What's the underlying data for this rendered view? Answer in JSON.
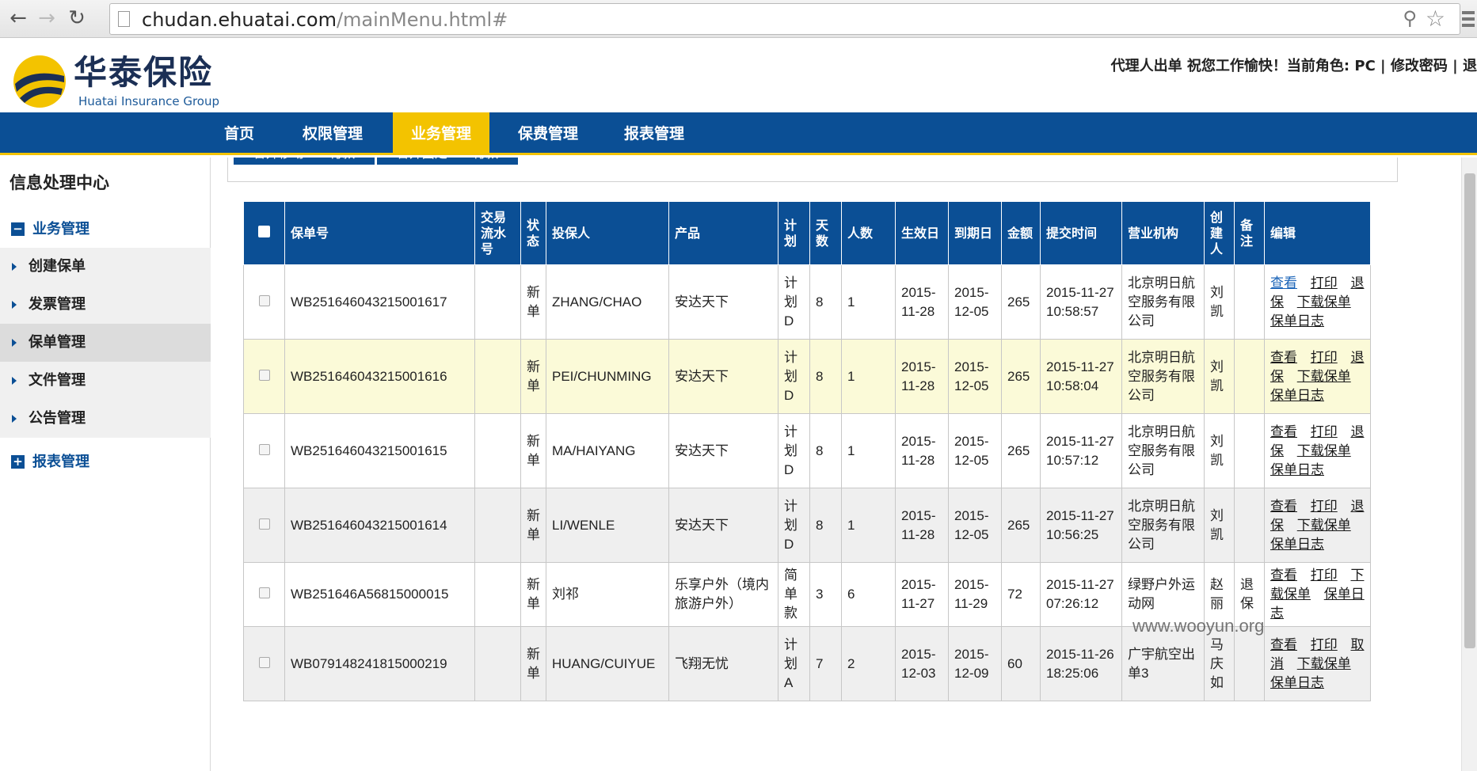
{
  "browser": {
    "url_host": "chudan.ehuatai.com",
    "url_path": "/mainMenu.html#"
  },
  "header": {
    "logo_cn": "华泰保险",
    "logo_en": "Huatai Insurance Group",
    "info": "代理人出单 祝您工作愉快！当前角色: PC | 修改密码 | 退"
  },
  "nav": [
    {
      "label": "首页"
    },
    {
      "label": "权限管理"
    },
    {
      "label": "业务管理",
      "active": true
    },
    {
      "label": "保费管理"
    },
    {
      "label": "报表管理"
    }
  ],
  "sidebar": {
    "title": "信息处理中心",
    "group1": "业务管理",
    "items": [
      {
        "label": "创建保单"
      },
      {
        "label": "发票管理"
      },
      {
        "label": "保单管理",
        "active": true
      },
      {
        "label": "文件管理"
      },
      {
        "label": "公告管理"
      }
    ],
    "group2": "报表管理"
  },
  "top_buttons": [
    "合并移动POS付款",
    "合并固定POS付款"
  ],
  "table": {
    "headers": [
      "保单号",
      "交易流水号",
      "状态",
      "投保人",
      "产品",
      "计划",
      "天数",
      "人数",
      "生效日",
      "到期日",
      "金额",
      "提交时间",
      "营业机构",
      "创建人",
      "备注",
      "编辑"
    ],
    "rows": [
      {
        "policy": "WB251646043215001617",
        "txn": "",
        "status": "新单",
        "holder": "ZHANG/CHAO",
        "product": "安达天下",
        "plan": "计划D",
        "days": "8",
        "people": "1",
        "start": "2015-11-28",
        "end": "2015-12-05",
        "amount": "265",
        "submit": "2015-11-27 10:58:57",
        "org": "北京明日航空服务有限公司",
        "creator": "刘凯",
        "note": "",
        "actions": [
          "查看",
          "打印",
          "退保",
          "下载保单",
          "保单日志"
        ]
      },
      {
        "policy": "WB251646043215001616",
        "txn": "",
        "status": "新单",
        "holder": "PEI/CHUNMING",
        "product": "安达天下",
        "plan": "计划D",
        "days": "8",
        "people": "1",
        "start": "2015-11-28",
        "end": "2015-12-05",
        "amount": "265",
        "submit": "2015-11-27 10:58:04",
        "org": "北京明日航空服务有限公司",
        "creator": "刘凯",
        "note": "",
        "actions": [
          "查看",
          "打印",
          "退保",
          "下载保单",
          "保单日志"
        ]
      },
      {
        "policy": "WB251646043215001615",
        "txn": "",
        "status": "新单",
        "holder": "MA/HAIYANG",
        "product": "安达天下",
        "plan": "计划D",
        "days": "8",
        "people": "1",
        "start": "2015-11-28",
        "end": "2015-12-05",
        "amount": "265",
        "submit": "2015-11-27 10:57:12",
        "org": "北京明日航空服务有限公司",
        "creator": "刘凯",
        "note": "",
        "actions": [
          "查看",
          "打印",
          "退保",
          "下载保单",
          "保单日志"
        ]
      },
      {
        "policy": "WB251646043215001614",
        "txn": "",
        "status": "新单",
        "holder": "LI/WENLE",
        "product": "安达天下",
        "plan": "计划D",
        "days": "8",
        "people": "1",
        "start": "2015-11-28",
        "end": "2015-12-05",
        "amount": "265",
        "submit": "2015-11-27 10:56:25",
        "org": "北京明日航空服务有限公司",
        "creator": "刘凯",
        "note": "",
        "actions": [
          "查看",
          "打印",
          "退保",
          "下载保单",
          "保单日志"
        ]
      },
      {
        "policy": "WB251646A56815000015",
        "txn": "",
        "status": "新单",
        "holder": "刘祁",
        "product": "乐享户外（境内旅游户外）",
        "plan": "简单款",
        "days": "3",
        "people": "6",
        "start": "2015-11-27",
        "end": "2015-11-29",
        "amount": "72",
        "submit": "2015-11-27 07:26:12",
        "org": "绿野户外运动网",
        "creator": "赵丽",
        "note": "退保",
        "actions": [
          "查看",
          "打印",
          "下载保单",
          "保单日志"
        ]
      },
      {
        "policy": "WB079148241815000219",
        "txn": "",
        "status": "新单",
        "holder": "HUANG/CUIYUE",
        "product": "飞翔无忧",
        "plan": "计划A",
        "days": "7",
        "people": "2",
        "start": "2015-12-03",
        "end": "2015-12-09",
        "amount": "60",
        "submit": "2015-11-26 18:25:06",
        "org": "广宇航空出单3",
        "creator": "马庆如",
        "note": "",
        "actions": [
          "查看",
          "打印",
          "取消",
          "下载保单",
          "保单日志"
        ]
      }
    ]
  },
  "watermark": "www.wooyun.org"
}
